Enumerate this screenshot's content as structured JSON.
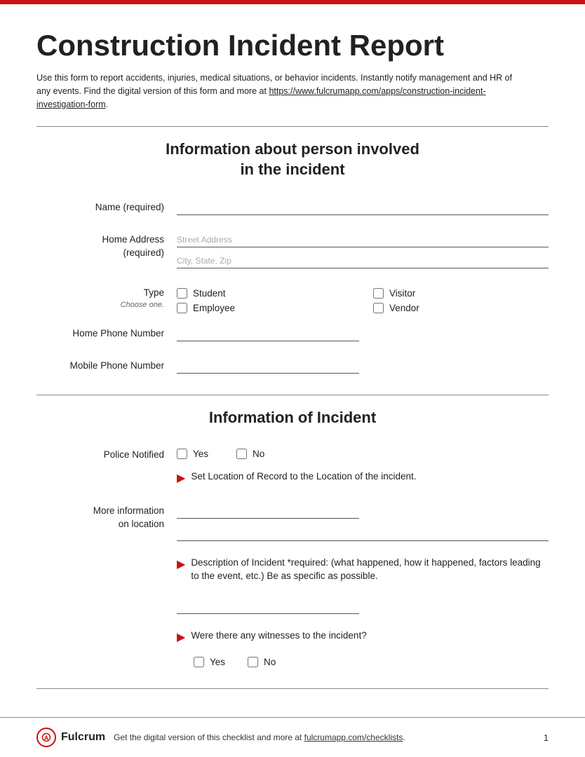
{
  "topBar": {
    "color": "#cc1111"
  },
  "title": "Construction Incident Report",
  "description": "Use this form to report accidents, injuries, medical situations, or behavior incidents. Instantly notify management and HR of any events. Find the digital version of this form and more at",
  "link": "https://www.fulcrumapp.com/apps/construction-incident-investigation-form",
  "section1": {
    "title": "Information about person involved\nin the incident",
    "fields": {
      "name_label": "Name (required)",
      "address_label": "Home Address\n(required)",
      "street_placeholder": "Street Address",
      "city_placeholder": "City, State, Zip",
      "type_label": "Type",
      "type_sub": "Choose one.",
      "type_options": [
        "Student",
        "Visitor",
        "Employee",
        "Vendor"
      ],
      "phone_label": "Home Phone Number",
      "mobile_label": "Mobile Phone Number"
    }
  },
  "section2": {
    "title": "Information of Incident",
    "police_label": "Police Notified",
    "police_options": [
      "Yes",
      "No"
    ],
    "arrow1": "Set Location of Record to the Location of the incident.",
    "location_label": "More information\non location",
    "arrow2": "Description of Incident *required: (what happened, how it happened, factors leading to the event, etc.) Be as specific as possible.",
    "arrow3": "Were there any witnesses to the incident?",
    "witness_options": [
      "Yes",
      "No"
    ]
  },
  "footer": {
    "brand": "Fulcrum",
    "text": "Get the digital version of this checklist and more at",
    "link": "fulcrumapp.com/checklists",
    "page": "1"
  }
}
